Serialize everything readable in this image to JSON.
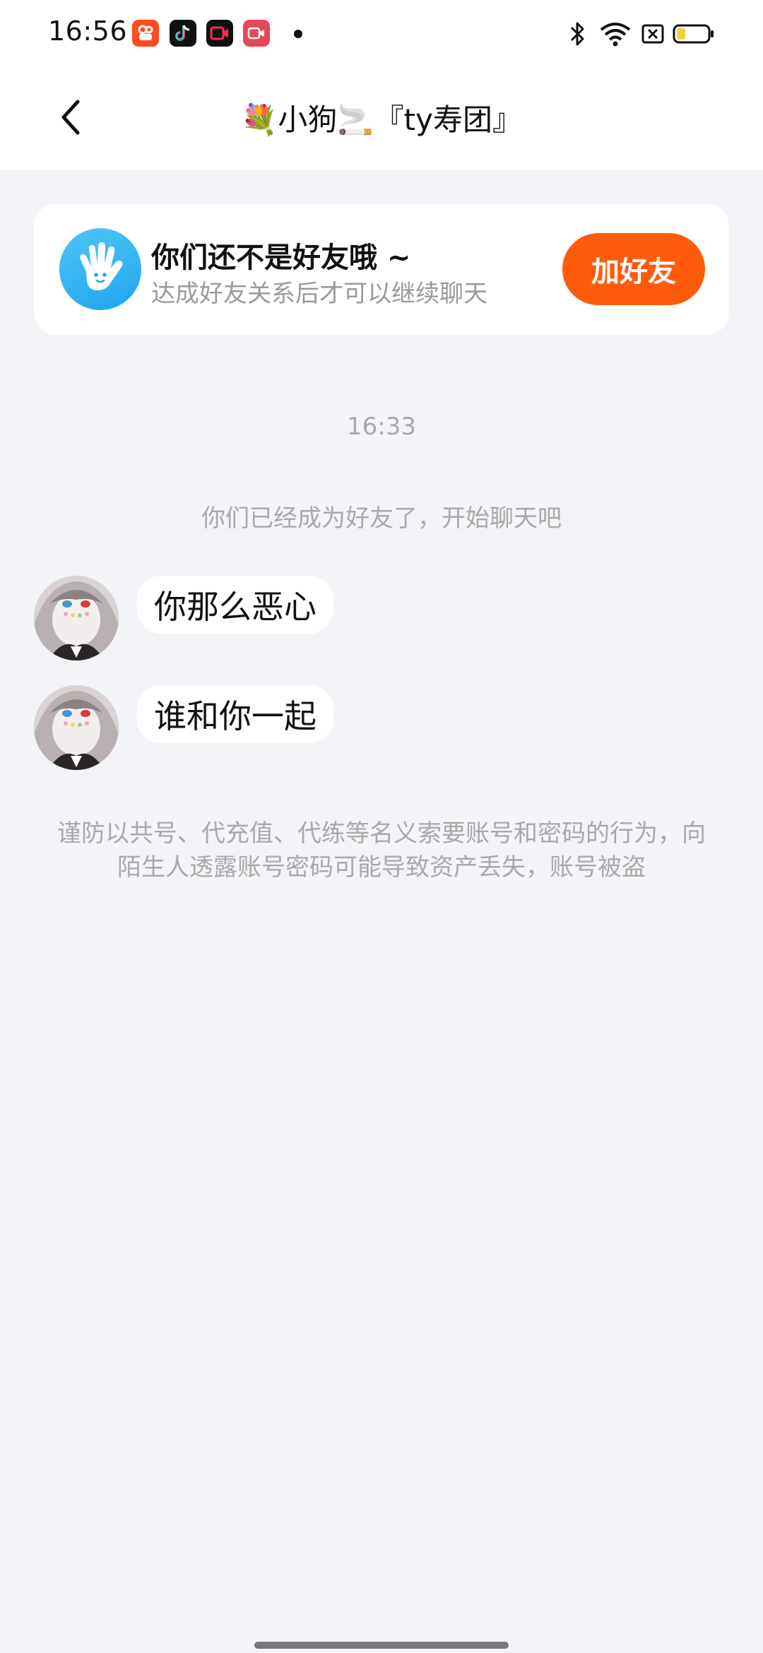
{
  "status_bar": {
    "time": "16:56",
    "apps": [
      "kuaishou-icon",
      "tiktok-icon",
      "screen-record-icon",
      "video-call-icon"
    ],
    "system_icons": [
      "bluetooth-icon",
      "wifi-icon",
      "sim-off-icon",
      "battery-icon"
    ]
  },
  "header": {
    "back_icon": "chevron-left-icon",
    "title": "💐小狗🚬『ty寿团』"
  },
  "friend_card": {
    "icon": "waving-hand-icon",
    "title": "你们还不是好友哦 ~",
    "subtitle": "达成好友关系后才可以继续聊天",
    "button_label": "加好友",
    "button_color": "#fe5b0d"
  },
  "chat": {
    "timestamp": "16:33",
    "system_message": "你们已经成为好友了，开始聊天吧",
    "messages": [
      {
        "sender": "other",
        "text": "你那么恶心"
      },
      {
        "sender": "other",
        "text": "谁和你一起"
      }
    ],
    "warning": "谨防以共号、代充值、代练等名义索要账号和密码的行为，向陌生人透露账号密码可能导致资产丢失，账号被盗"
  },
  "colors": {
    "page_background": "#f2f4f7",
    "accent": "#fe5b0d",
    "muted_text": "#a9a9a9"
  }
}
